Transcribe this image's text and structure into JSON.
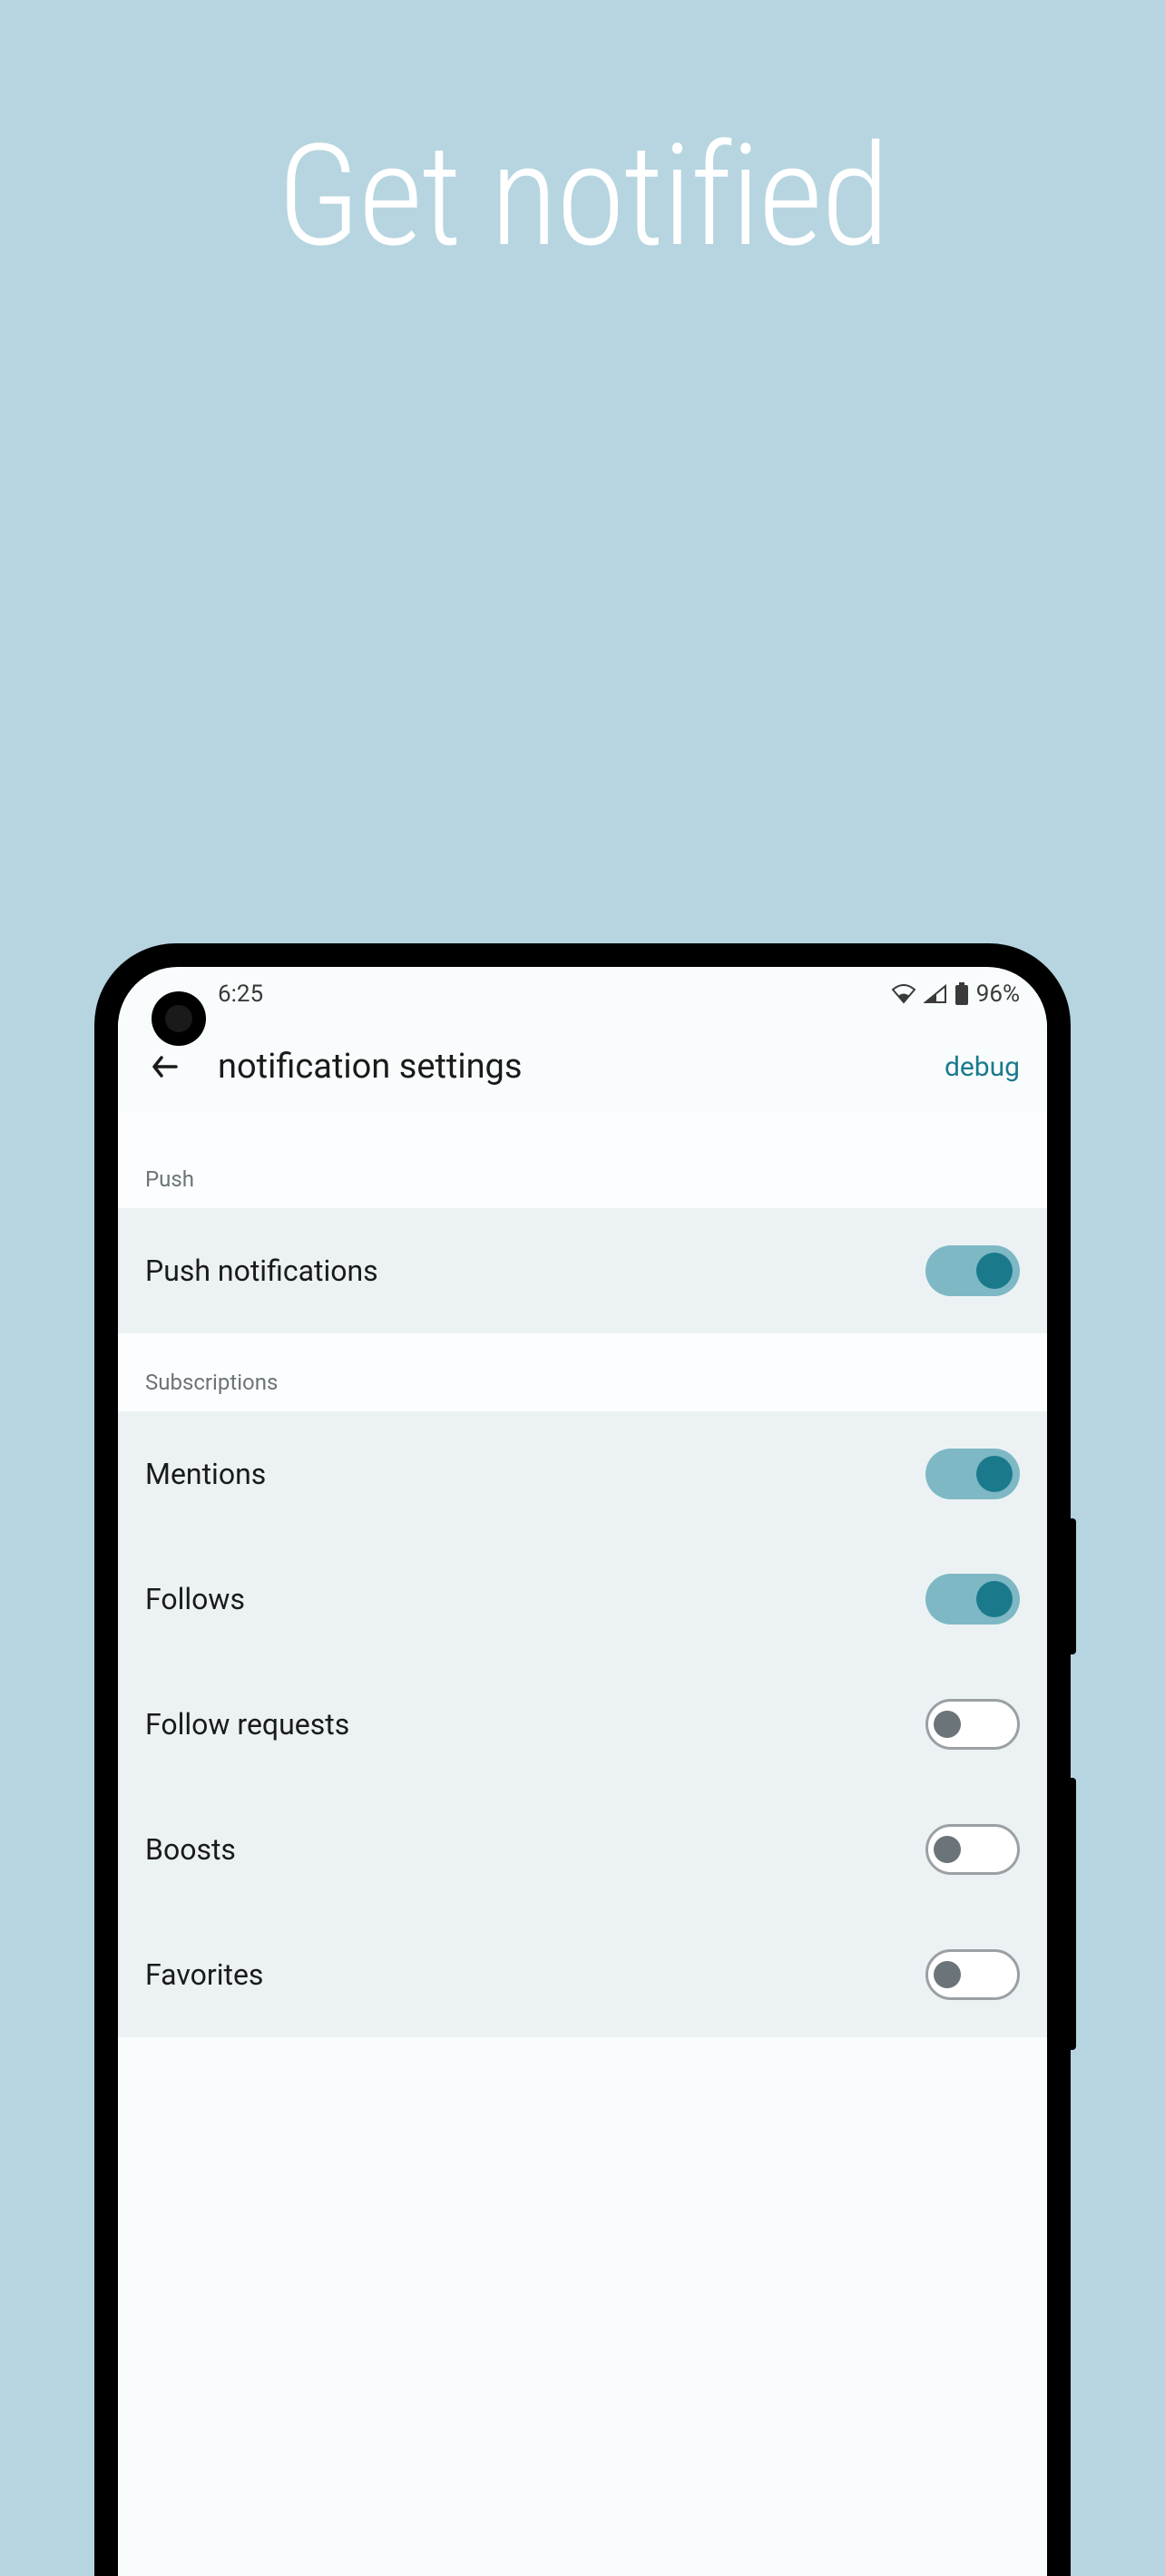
{
  "hero": {
    "title": "Get notified"
  },
  "statusBar": {
    "time": "6:25",
    "battery": "96%"
  },
  "appBar": {
    "title": "notification settings",
    "action": "debug"
  },
  "sections": {
    "push": {
      "header": "Push",
      "items": {
        "pushNotifications": {
          "label": "Push notifications",
          "enabled": true
        }
      }
    },
    "subscriptions": {
      "header": "Subscriptions",
      "items": {
        "mentions": {
          "label": "Mentions",
          "enabled": true
        },
        "follows": {
          "label": "Follows",
          "enabled": true
        },
        "followRequests": {
          "label": "Follow requests",
          "enabled": false
        },
        "boosts": {
          "label": "Boosts",
          "enabled": false
        },
        "favorites": {
          "label": "Favorites",
          "enabled": false
        }
      }
    }
  }
}
